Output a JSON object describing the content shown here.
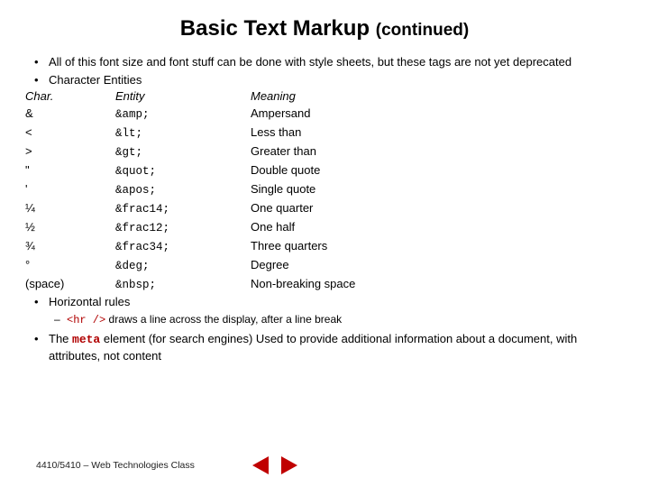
{
  "title_main": "Basic Text Markup",
  "title_cont": "(continued)",
  "bullet1": "All of this font size and font stuff can be done with style sheets, but these tags are not yet deprecated",
  "bullet2": "Character Entities",
  "headers": {
    "c1": "Char.",
    "c2": "Entity",
    "c3": "Meaning"
  },
  "rows": [
    {
      "c1": "&",
      "c2": "&amp;",
      "c3": "Ampersand"
    },
    {
      "c1": "<",
      "c2": "&lt;",
      "c3": "Less than"
    },
    {
      "c1": ">",
      "c2": "&gt;",
      "c3": "Greater than"
    },
    {
      "c1": "\"",
      "c2": "&quot;",
      "c3": "Double quote"
    },
    {
      "c1": "'",
      "c2": "&apos;",
      "c3": "Single quote"
    },
    {
      "c1": "¼",
      "c2": "&frac14;",
      "c3": "One quarter"
    },
    {
      "c1": "½",
      "c2": "&frac12;",
      "c3": "One half"
    },
    {
      "c1": "¾",
      "c2": "&frac34;",
      "c3": "Three quarters"
    },
    {
      "c1": "°",
      "c2": "&deg;",
      "c3": "Degree"
    },
    {
      "c1": "(space)",
      "c2": "&nbsp;",
      "c3": "Non-breaking space"
    }
  ],
  "bullet3": "Horizontal rules",
  "sub_code": "<hr />",
  "sub_rest": " draws a line across the display, after a line break",
  "bullet4_pre": "The ",
  "bullet4_code": "meta",
  "bullet4_post": " element (for search engines) Used to provide additional information about a document, with attributes, not content",
  "footer": "4410/5410 – Web Technologies  Class"
}
